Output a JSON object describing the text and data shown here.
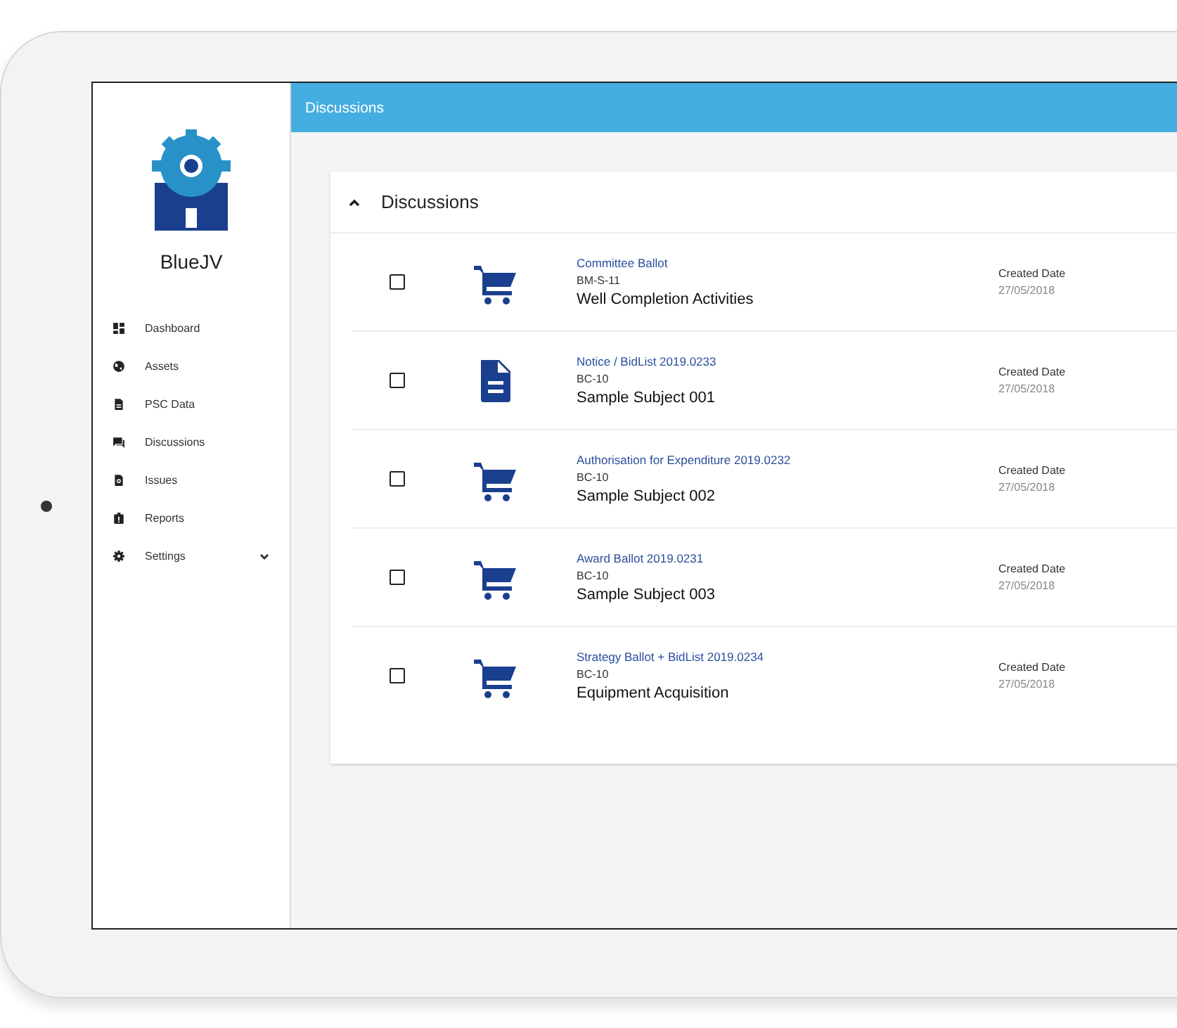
{
  "app": {
    "name": "BlueJV"
  },
  "sidebar": {
    "items": [
      {
        "label": "Dashboard",
        "kind": "dashboard",
        "expandable": false
      },
      {
        "label": "Assets",
        "kind": "globe",
        "expandable": false
      },
      {
        "label": "PSC Data",
        "kind": "file",
        "expandable": false
      },
      {
        "label": "Discussions",
        "kind": "chat",
        "expandable": false
      },
      {
        "label": "Issues",
        "kind": "search",
        "expandable": false
      },
      {
        "label": "Reports",
        "kind": "clipboard",
        "expandable": false
      },
      {
        "label": "Settings",
        "kind": "gear",
        "expandable": true
      }
    ]
  },
  "header": {
    "title": "Discussions"
  },
  "panel": {
    "title": "Discussions",
    "expanded": true,
    "rows": [
      {
        "checked": false,
        "kind": "cart",
        "type": "Committee Ballot",
        "code": "BM-S-11",
        "subject": "Well Completion Activities",
        "date_label": "Created Date",
        "date": "27/05/2018"
      },
      {
        "checked": false,
        "kind": "document",
        "type": "Notice / BidList 2019.0233",
        "code": "BC-10",
        "subject": "Sample Subject 001",
        "date_label": "Created Date",
        "date": "27/05/2018"
      },
      {
        "checked": false,
        "kind": "cart",
        "type": "Authorisation for Expenditure 2019.0232",
        "code": "BC-10",
        "subject": "Sample Subject 002",
        "date_label": "Created Date",
        "date": "27/05/2018"
      },
      {
        "checked": false,
        "kind": "cart",
        "type": "Award Ballot 2019.0231",
        "code": "BC-10",
        "subject": "Sample Subject 003",
        "date_label": "Created Date",
        "date": "27/05/2018"
      },
      {
        "checked": false,
        "kind": "cart",
        "type": "Strategy Ballot + BidList 2019.0234",
        "code": "BC-10",
        "subject": "Equipment Acquisition",
        "date_label": "Created Date",
        "date": "27/05/2018"
      }
    ]
  }
}
